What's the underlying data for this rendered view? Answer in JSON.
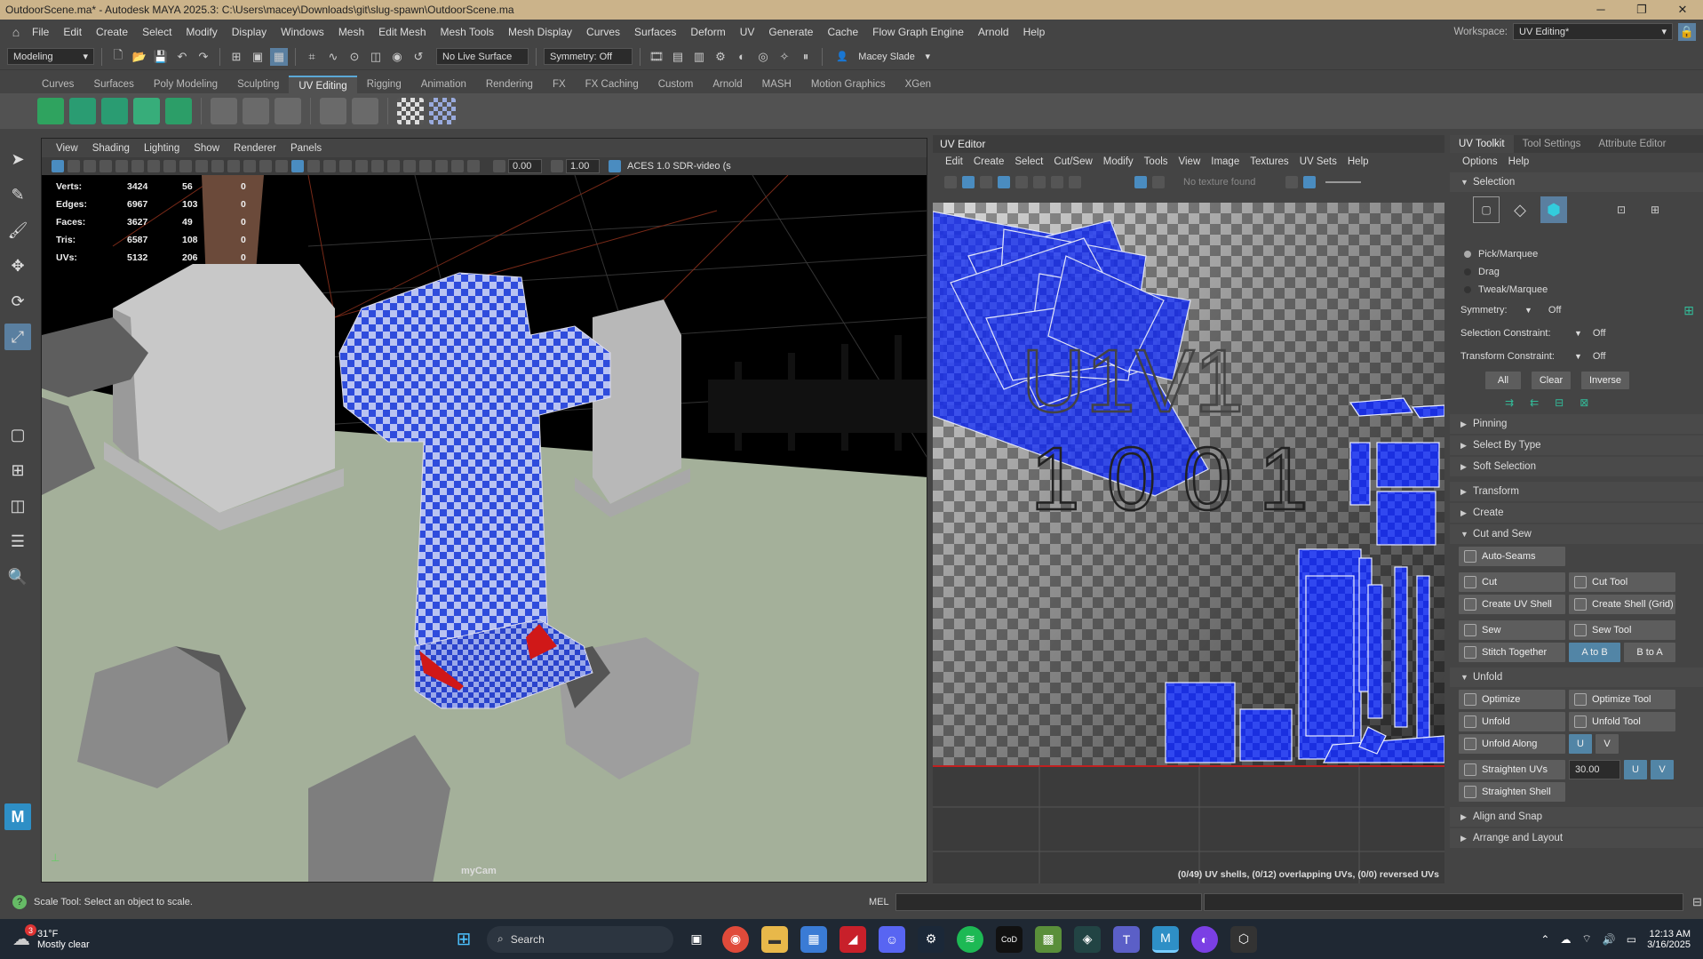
{
  "titlebar": {
    "title": "OutdoorScene.ma* - Autodesk MAYA 2025.3: C:\\Users\\macey\\Downloads\\git\\slug-spawn\\OutdoorScene.ma",
    "minimize": "─",
    "maximize": "❐",
    "close": "✕"
  },
  "menubar": {
    "items": [
      "File",
      "Edit",
      "Create",
      "Select",
      "Modify",
      "Display",
      "Windows",
      "Mesh",
      "Edit Mesh",
      "Mesh Tools",
      "Mesh Display",
      "Curves",
      "Surfaces",
      "Deform",
      "UV",
      "Generate",
      "Cache",
      "Flow Graph Engine",
      "Arnold",
      "Help"
    ],
    "workspace_label": "Workspace:",
    "workspace_value": "UV Editing*"
  },
  "statusline": {
    "menuset": "Modeling",
    "live_surface": "No Live Surface",
    "symmetry": "Symmetry: Off",
    "user": "Macey Slade"
  },
  "shelf": {
    "tabs": [
      "Curves",
      "Surfaces",
      "Poly Modeling",
      "Sculpting",
      "UV Editing",
      "Rigging",
      "Animation",
      "Rendering",
      "FX",
      "FX Caching",
      "Custom",
      "Arnold",
      "MASH",
      "Motion Graphics",
      "XGen"
    ],
    "active": "UV Editing"
  },
  "viewport": {
    "menu": [
      "View",
      "Shading",
      "Lighting",
      "Show",
      "Renderer",
      "Panels"
    ],
    "exposure": "0.00",
    "gamma": "1.00",
    "colorspace": "ACES 1.0 SDR-video (s",
    "hud": [
      {
        "label": "Verts:",
        "a": "3424",
        "b": "56",
        "c": "0"
      },
      {
        "label": "Edges:",
        "a": "6967",
        "b": "103",
        "c": "0"
      },
      {
        "label": "Faces:",
        "a": "3627",
        "b": "49",
        "c": "0"
      },
      {
        "label": "Tris:",
        "a": "6587",
        "b": "108",
        "c": "0"
      },
      {
        "label": "UVs:",
        "a": "5132",
        "b": "206",
        "c": "0"
      }
    ],
    "camera": "myCam"
  },
  "uv_editor": {
    "title": "UV Editor",
    "menu": [
      "Edit",
      "Create",
      "Select",
      "Cut/Sew",
      "Modify",
      "Tools",
      "View",
      "Image",
      "Textures",
      "UV Sets",
      "Help"
    ],
    "texture_status": "No texture found",
    "tile_label_1": "U1V1",
    "tile_label_2": "1001",
    "status": "(0/49) UV shells, (0/12) overlapping UVs, (0/0) reversed UVs"
  },
  "uv_toolkit": {
    "tabs": [
      "UV Toolkit",
      "Tool Settings",
      "Attribute Editor"
    ],
    "menu": [
      "Options",
      "Help"
    ],
    "selection_header": "Selection",
    "radio": [
      "Pick/Marquee",
      "Drag",
      "Tweak/Marquee"
    ],
    "symmetry_label": "Symmetry:",
    "symmetry_value": "Off",
    "sel_constraint_label": "Selection Constraint:",
    "sel_constraint_value": "Off",
    "transform_constraint_label": "Transform Constraint:",
    "transform_constraint_value": "Off",
    "btn_all": "All",
    "btn_clear": "Clear",
    "btn_inverse": "Inverse",
    "pinning": "Pinning",
    "select_by_type": "Select By Type",
    "soft_selection": "Soft Selection",
    "transform": "Transform",
    "create": "Create",
    "cut_and_sew": "Cut and Sew",
    "auto_seams": "Auto-Seams",
    "cut": "Cut",
    "cut_tool": "Cut Tool",
    "create_uv_shell": "Create UV Shell",
    "create_shell_grid": "Create Shell (Grid)",
    "sew": "Sew",
    "sew_tool": "Sew Tool",
    "stitch_together": "Stitch Together",
    "a_to_b": "A to B",
    "b_to_a": "B to A",
    "unfold_header": "Unfold",
    "optimize": "Optimize",
    "optimize_tool": "Optimize Tool",
    "unfold": "Unfold",
    "unfold_tool": "Unfold Tool",
    "unfold_along": "Unfold Along",
    "u": "U",
    "v": "V",
    "straighten_uvs": "Straighten UVs",
    "straighten_value": "30.00",
    "straighten_shell": "Straighten Shell",
    "align_and_snap": "Align and Snap",
    "arrange_and_layout": "Arrange and Layout"
  },
  "cmdline": {
    "help": "Scale Tool: Select an object to scale.",
    "mel": "MEL"
  },
  "taskbar": {
    "temp": "31°F",
    "weather": "Mostly clear",
    "badge": "3",
    "search": "Search",
    "time": "12:13 AM",
    "date": "3/16/2025"
  }
}
